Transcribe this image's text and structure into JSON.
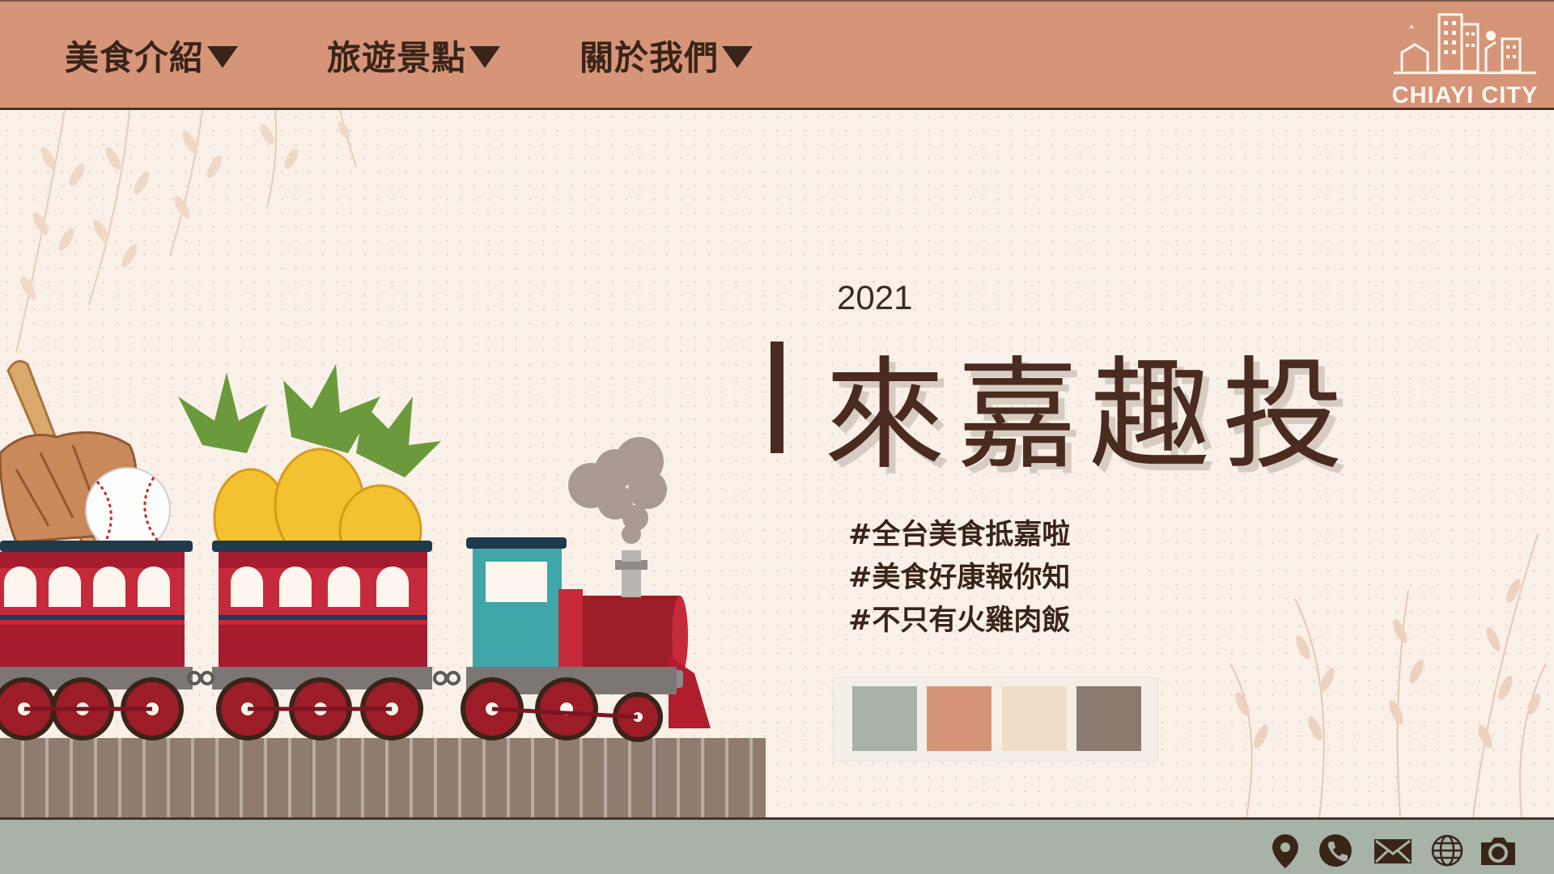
{
  "nav": {
    "items": [
      {
        "label": "美食介紹"
      },
      {
        "label": "旅遊景點"
      },
      {
        "label": "關於我們"
      }
    ]
  },
  "logo": {
    "text": "CHIAYI CITY"
  },
  "hero": {
    "year": "2021",
    "title": "來嘉趣投",
    "tags": [
      "#全台美食抵嘉啦",
      "#美食好康報你知",
      "#不只有火雞肉飯"
    ]
  },
  "palette": {
    "colors": [
      "#a6b3a6",
      "#d69579",
      "#f0dcc6",
      "#8a7a70"
    ]
  },
  "footer": {
    "icons": [
      "location-pin-icon",
      "phone-icon",
      "mail-icon",
      "globe-icon",
      "camera-icon"
    ]
  },
  "colors": {
    "header": "#d69579",
    "footer": "#a6b3a6",
    "text_dark": "#3a2418",
    "background": "#f9f0e8"
  }
}
